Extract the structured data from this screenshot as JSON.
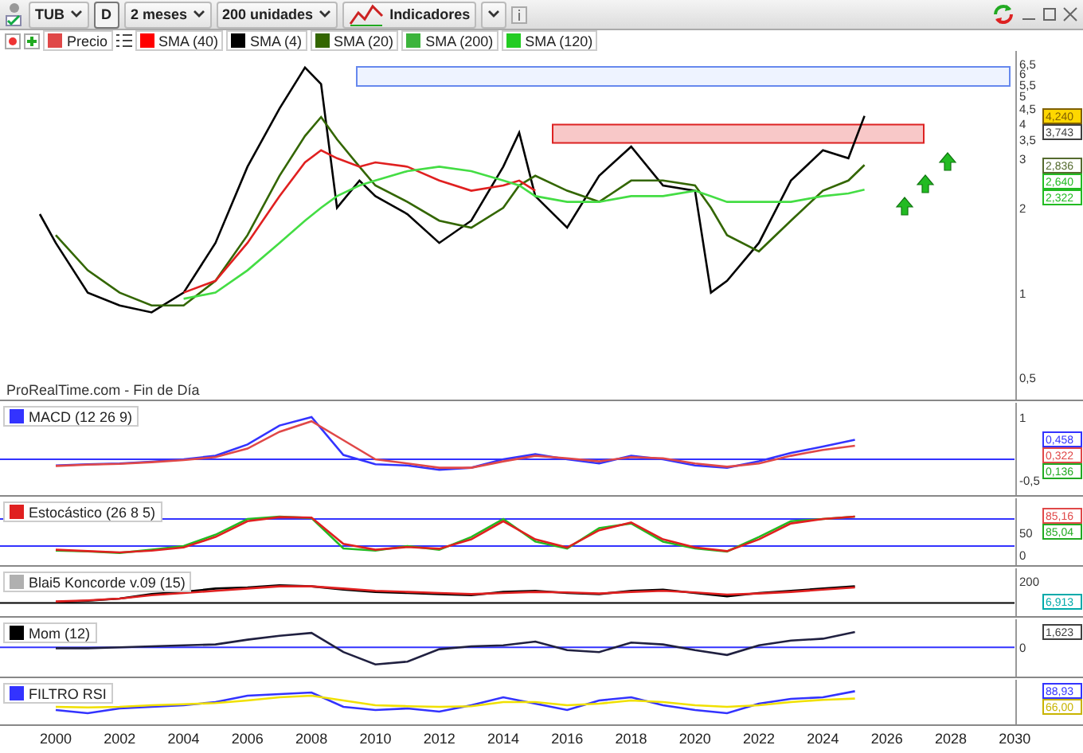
{
  "toolbar": {
    "symbol": "TUB",
    "period_button": "D",
    "timeframe": "2 meses",
    "units": "200 unidades",
    "indicators_button": "Indicadores"
  },
  "legend": [
    {
      "label": "Precio",
      "color": "#e04848"
    },
    {
      "label": "SMA (40)",
      "color": "#ff0000"
    },
    {
      "label": "SMA (4)",
      "color": "#000000"
    },
    {
      "label": "SMA (20)",
      "color": "#336600"
    },
    {
      "label": "SMA (200)",
      "color": "#3cb43c"
    },
    {
      "label": "SMA (120)",
      "color": "#22cc22"
    }
  ],
  "main_chart": {
    "source_note": "ProRealTime.com - Fin de Día",
    "axis_labels": [
      "6,5",
      "6",
      "5,5",
      "5",
      "4,5",
      "4",
      "3,5",
      "3",
      "2",
      "1",
      "0,5"
    ],
    "readouts": [
      {
        "text": "4,240",
        "color": "#806000",
        "highlighted": true
      },
      {
        "text": "3,743",
        "color": "#404040",
        "highlighted": false
      },
      {
        "text": "2,836",
        "color": "#556b2f",
        "highlighted": false
      },
      {
        "text": "2,640",
        "color": "#22bb22",
        "highlighted": false
      },
      {
        "text": "2,322",
        "color": "#22bb22",
        "highlighted": false
      }
    ]
  },
  "indicators": [
    {
      "label": "MACD (12 26 9)",
      "color": "#3333ff",
      "axis_labels": [
        "1",
        "-0,5"
      ],
      "readouts": [
        {
          "text": "0,458",
          "color": "#3333ff"
        },
        {
          "text": "0,322",
          "color": "#e04848"
        },
        {
          "text": "0,136",
          "color": "#22aa22"
        }
      ]
    },
    {
      "label": "Estocástico (26 8 5)",
      "color": "#e02020",
      "axis_labels": [
        "50",
        "0"
      ],
      "readouts": [
        {
          "text": "85,16",
          "color": "#e04848"
        },
        {
          "text": "85,04",
          "color": "#22aa22"
        }
      ]
    },
    {
      "label": "Blai5 Koncorde v.09 (15)",
      "color": "#b0b0b0",
      "axis_labels": [
        "200"
      ],
      "readouts": [
        {
          "text": "6,913",
          "color": "#00aaaa"
        }
      ]
    },
    {
      "label": "Mom (12)",
      "color": "#000000",
      "axis_labels": [
        "0"
      ],
      "readouts": [
        {
          "text": "1,623",
          "color": "#404040"
        }
      ]
    },
    {
      "label": "FILTRO RSI",
      "color": "#3333ff",
      "readouts": [
        {
          "text": "88,93",
          "color": "#3333ff"
        },
        {
          "text": "66,00",
          "color": "#c8b400"
        }
      ]
    }
  ],
  "x_axis": {
    "labels": [
      "2000",
      "2002",
      "2004",
      "2006",
      "2008",
      "2010",
      "2012",
      "2014",
      "2016",
      "2018",
      "2020",
      "2022",
      "2024",
      "2026",
      "2028",
      "2030"
    ]
  }
}
